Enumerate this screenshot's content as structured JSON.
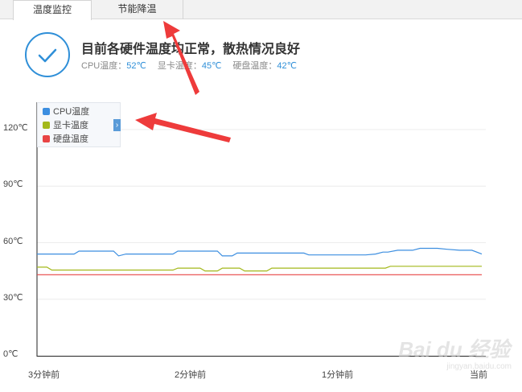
{
  "tabs": [
    {
      "label": "温度监控",
      "active": true
    },
    {
      "label": "节能降温",
      "active": false
    }
  ],
  "status": {
    "title": "目前各硬件温度均正常，散热情况良好",
    "icon": "check-circle-icon",
    "readings": [
      {
        "label": "CPU温度：",
        "value": "52℃"
      },
      {
        "label": "显卡温度：",
        "value": "45℃"
      },
      {
        "label": "硬盘温度：",
        "value": "42℃"
      }
    ]
  },
  "legend": {
    "items": [
      {
        "label": "CPU温度",
        "color": "#3c8ee0"
      },
      {
        "label": "显卡温度",
        "color": "#a3b81a"
      },
      {
        "label": "硬盘温度",
        "color": "#e84444"
      }
    ],
    "toggle_glyph": "›"
  },
  "watermark": {
    "brand": "Bai du 经验",
    "url": "jingyan.baidu.com"
  },
  "chart_data": {
    "type": "line",
    "y_tick_labels": [
      "0℃",
      "30℃",
      "60℃",
      "90℃",
      "120℃"
    ],
    "x_tick_labels": [
      "3分钟前",
      "2分钟前",
      "1分钟前",
      "当前"
    ],
    "x_minutes_ago": [
      180,
      120,
      60,
      0
    ],
    "ylim": [
      0,
      120
    ],
    "grid": true,
    "legend_position": "top-left",
    "series": [
      {
        "name": "CPU温度",
        "color": "#3c8ee0",
        "x": [
          180,
          165,
          163,
          149,
          147,
          144,
          125,
          123,
          107,
          105,
          101,
          99,
          95,
          72,
          70,
          47,
          43,
          40,
          38,
          34,
          28,
          25,
          18,
          14,
          9,
          4,
          0
        ],
        "y": [
          54,
          54,
          55.5,
          55.5,
          53,
          54,
          54,
          55.5,
          55.5,
          53,
          53,
          54.5,
          54.5,
          54.5,
          53.5,
          53.5,
          54,
          55,
          55,
          56,
          56,
          57,
          57,
          56.5,
          56,
          56,
          54
        ]
      },
      {
        "name": "显卡温度",
        "color": "#a3b81a",
        "x": [
          180,
          176,
          174,
          125,
          123,
          114,
          112,
          107,
          105,
          98,
          96,
          87,
          85,
          39,
          37,
          0
        ],
        "y": [
          47,
          47,
          45.5,
          45.5,
          46.5,
          46.5,
          45,
          45,
          46.5,
          46.5,
          45,
          45,
          46.5,
          46.5,
          47.5,
          47.5
        ]
      },
      {
        "name": "硬盘温度",
        "color": "#e84444",
        "x": [
          180,
          0
        ],
        "y": [
          43,
          43
        ]
      }
    ]
  }
}
